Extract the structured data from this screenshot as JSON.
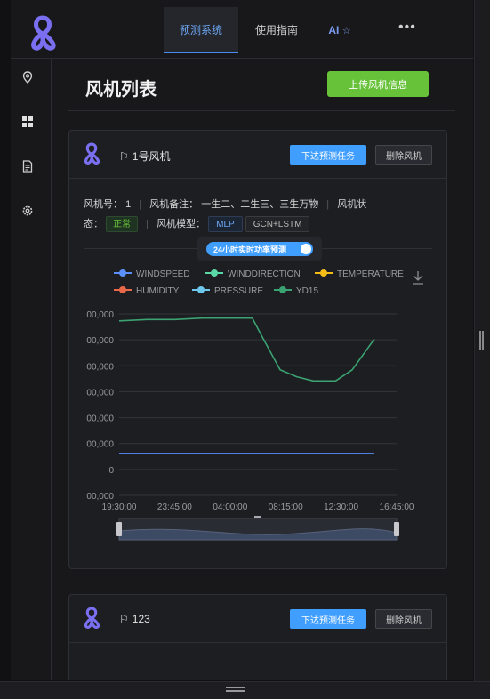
{
  "nav": {
    "tabs": [
      {
        "label": "预测系统",
        "active": true
      },
      {
        "label": "使用指南",
        "active": false
      },
      {
        "label": "AI",
        "active": false
      }
    ],
    "more": "•••"
  },
  "sidebar": {
    "icons": [
      "location-icon",
      "grid-icon",
      "document-icon",
      "settings-icon"
    ]
  },
  "page": {
    "title": "风机列表",
    "upload_label": "上传风机信息"
  },
  "cards": [
    {
      "title": "1号风机",
      "task_label": "下达预测任务",
      "delete_label": "删除风机",
      "info": {
        "id_label": "风机号：",
        "id_value": "1",
        "note_label": "风机备注：",
        "note_value": "一生二、二生三、三生万物",
        "status_label_a": "风机状",
        "status_label_b": "态：",
        "status_value": "正常",
        "model_label": "风机模型：",
        "models": [
          "MLP",
          "GCN+LSTM"
        ]
      },
      "switch_label": "24小时实时功率预测"
    },
    {
      "title": "123",
      "task_label": "下达预测任务",
      "delete_label": "删除风机"
    }
  ],
  "chart_data": {
    "type": "line",
    "legend": [
      "WINDSPEED",
      "WINDDIRECTION",
      "TEMPERATURE",
      "HUMIDITY",
      "PRESSURE",
      "YD15"
    ],
    "legend_colors": [
      "#5b8ff9",
      "#5ad8a6",
      "#f6bd16",
      "#e8684a",
      "#6dc8ec",
      "#3ba272"
    ],
    "x_ticks": [
      "19:30:00",
      "23:45:00",
      "04:00:00",
      "08:15:00",
      "12:30:00",
      "16:45:00"
    ],
    "y_ticks": [
      "00,000",
      "00,000",
      "00,000",
      "00,000",
      "00,000",
      "00,000",
      "0",
      "00,000"
    ],
    "series": [
      {
        "name": "YD15",
        "x": [
          0,
          10,
          20,
          30,
          40,
          48,
          52,
          58,
          64,
          70,
          78,
          84,
          92
        ],
        "values": [
          95,
          96,
          96,
          97,
          97,
          97,
          82,
          60,
          55,
          52,
          52,
          60,
          82
        ]
      },
      {
        "name": "WINDSPEED",
        "x": [
          0,
          92
        ],
        "values": [
          0,
          0
        ]
      }
    ],
    "xlim": [
      0,
      100
    ],
    "ylim": [
      -30,
      100
    ]
  }
}
